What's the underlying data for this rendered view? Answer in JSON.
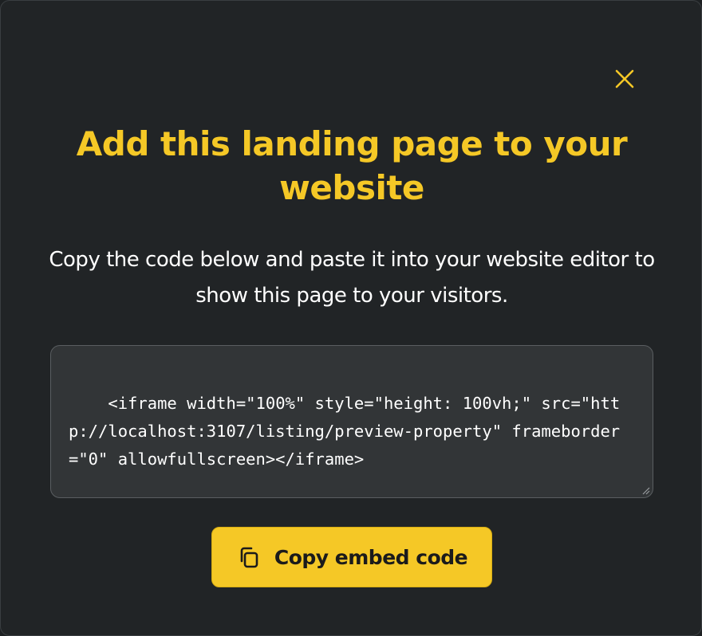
{
  "dialog": {
    "title": "Add this landing page to your website",
    "description": "Copy the code below and paste it into your website editor to show this page to your visitors.",
    "embed_code": "<iframe width=\"100%\" style=\"height: 100vh;\" src=\"http://localhost:3107/listing/preview-property\" frameborder=\"0\" allowfullscreen></iframe>",
    "copy_button_label": "Copy embed code",
    "close_icon": "close-icon",
    "copy_icon": "copy-icon"
  },
  "colors": {
    "accent": "#f5c826",
    "background": "#212426",
    "code_background": "#323537",
    "text": "#ffffff"
  }
}
